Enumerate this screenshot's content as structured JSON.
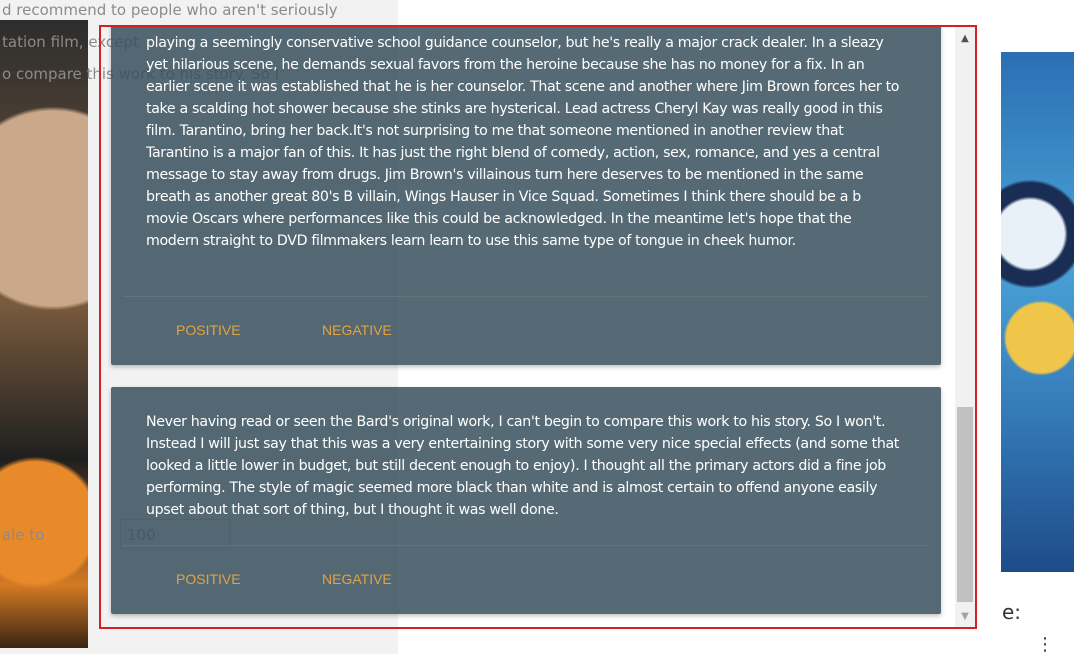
{
  "background": {
    "lines": [
      "d recommend to people who aren't seriously",
      "tation film, except",
      "o compare this work to his story. So I"
    ],
    "input_value": "100",
    "partial_label": "ale to ",
    "right_text": "e:",
    "right_menu": "⋮"
  },
  "reviews": [
    {
      "text": "playing a seemingly conservative school guidance counselor, but he's really a major crack dealer. In a sleazy yet hilarious scene, he demands sexual favors from the heroine because she has no money for a fix. In an earlier scene it was established that he is her counselor. That scene and another where Jim Brown forces her to take a scalding hot shower because she stinks are hysterical. Lead actress Cheryl Kay was really good in this film. Tarantino, bring her back.It's not surprising to me that someone mentioned in another review that Tarantino is a major fan of this. It has just the right blend of comedy, action, sex, romance, and yes a central message to stay away from drugs. Jim Brown's villainous turn here deserves to be mentioned in the same breath as another great 80's B villain, Wings Hauser in Vice Squad. Sometimes I think there should be a b movie Oscars where performances like this could be acknowledged. In the meantime let's hope that the modern straight to DVD filmmakers learn learn to use this same type of tongue in cheek humor.",
      "positive_label": "POSITIVE",
      "negative_label": "NEGATIVE"
    },
    {
      "text": "Never having read or seen the Bard's original work, I can't begin to compare this work to his story. So I won't. Instead I will just say that this was a very entertaining story with some very nice special effects (and some that looked a little lower in budget, but still decent enough to enjoy). I thought all the primary actors did a fine job performing. The style of magic seemed more black than white and is almost certain to offend anyone easily upset about that sort of thing, but I thought it was well done.",
      "positive_label": "POSITIVE",
      "negative_label": "NEGATIVE"
    }
  ],
  "scrollbar": {
    "up_arrow": "▲",
    "down_arrow": "▼"
  }
}
